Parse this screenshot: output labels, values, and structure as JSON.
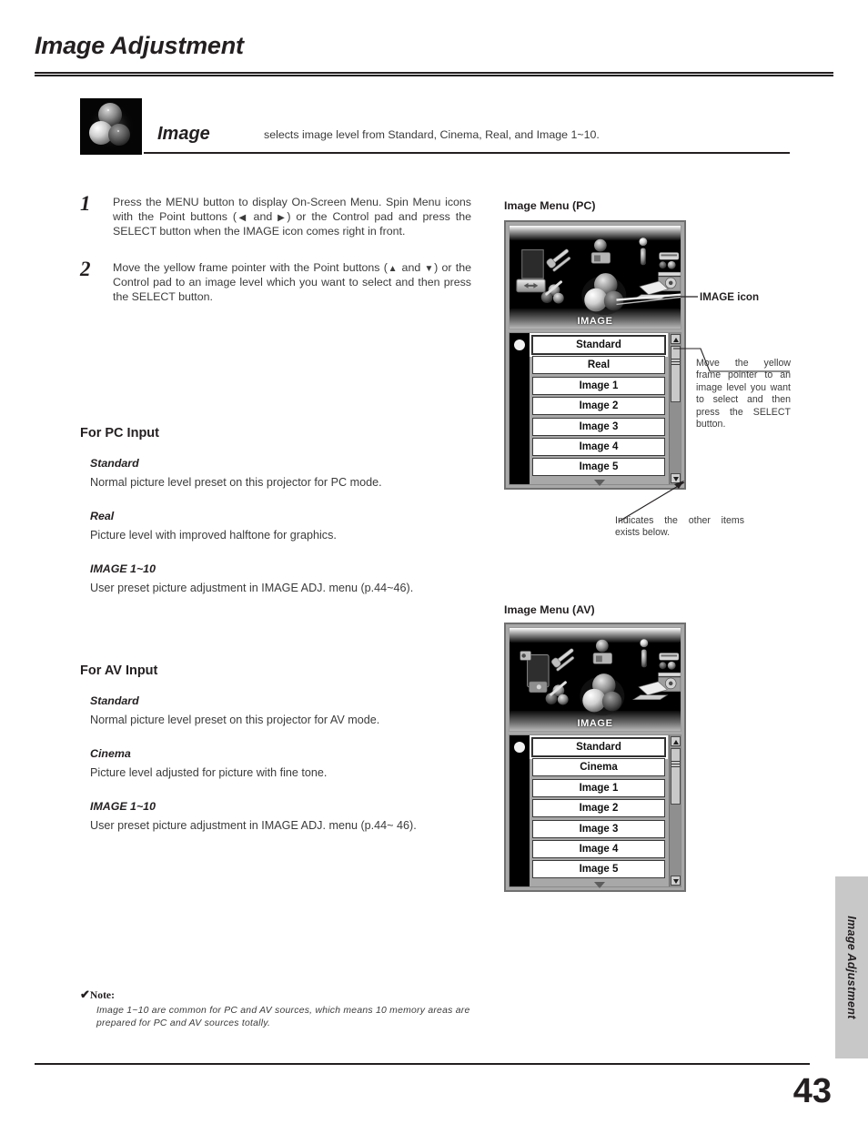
{
  "header": {
    "title": "Image Adjustment"
  },
  "feature": {
    "icon_name": "image-spheres-icon",
    "name": "Image",
    "description": "selects image level from Standard, Cinema, Real, and Image 1~10."
  },
  "steps": [
    {
      "number": "1",
      "text_parts": {
        "a": "Press the MENU button to display On-Screen Menu. Spin Menu icons with the Point buttons (",
        "left_glyph": "◀",
        "b": " and ",
        "right_glyph": "▶",
        "c": ") or the Control pad and press the SELECT button when the IMAGE icon comes right in front."
      }
    },
    {
      "number": "2",
      "text_parts": {
        "a": "Move the yellow frame pointer with the Point buttons (",
        "up_glyph": "▲",
        "b": " and ",
        "down_glyph": "▼",
        "c": ") or the Control pad to an image level which you want to select and then press the SELECT button."
      }
    }
  ],
  "pc_section": {
    "title": "For PC Input",
    "entries": [
      {
        "name": "Standard",
        "body": "Normal picture level preset on this projector for PC mode."
      },
      {
        "name": "Real",
        "body": "Picture level with improved halftone for graphics."
      },
      {
        "name": "IMAGE 1~10",
        "body": "User preset picture adjustment in IMAGE ADJ. menu (p.44~46)."
      }
    ]
  },
  "av_section": {
    "title": "For AV Input",
    "entries": [
      {
        "name": "Standard",
        "body": "Normal picture level preset on this projector for AV mode."
      },
      {
        "name": "Cinema",
        "body": "Picture level adjusted for picture with fine tone."
      },
      {
        "name": "IMAGE 1~10",
        "body": "User preset picture adjustment in IMAGE ADJ. menu (p.44~ 46)."
      }
    ]
  },
  "pc_menu": {
    "label": "Image Menu (PC)",
    "screen_caption": "IMAGE",
    "items": [
      "Standard",
      "Real",
      "Image 1",
      "Image 2",
      "Image 3",
      "Image 4",
      "Image 5"
    ],
    "selected_item": "Standard"
  },
  "av_menu": {
    "label": "Image Menu (AV)",
    "screen_caption": "IMAGE",
    "items": [
      "Standard",
      "Cinema",
      "Image 1",
      "Image 2",
      "Image 3",
      "Image 4",
      "Image 5"
    ],
    "selected_item": "Standard"
  },
  "callouts": {
    "image_icon": "IMAGE icon",
    "move_pointer": "Move the yellow frame pointer to an image level you want to select and then press the SELECT button.",
    "indicates_below": "Indicates the other items exists below."
  },
  "note": {
    "check_glyph": "✔",
    "heading": "Note:",
    "body": "Image 1~10 are common for PC and AV sources, which means 10 memory areas are prepared for PC and AV sources totally."
  },
  "side_tab": {
    "label": "Image Adjustment"
  },
  "page_number": "43"
}
